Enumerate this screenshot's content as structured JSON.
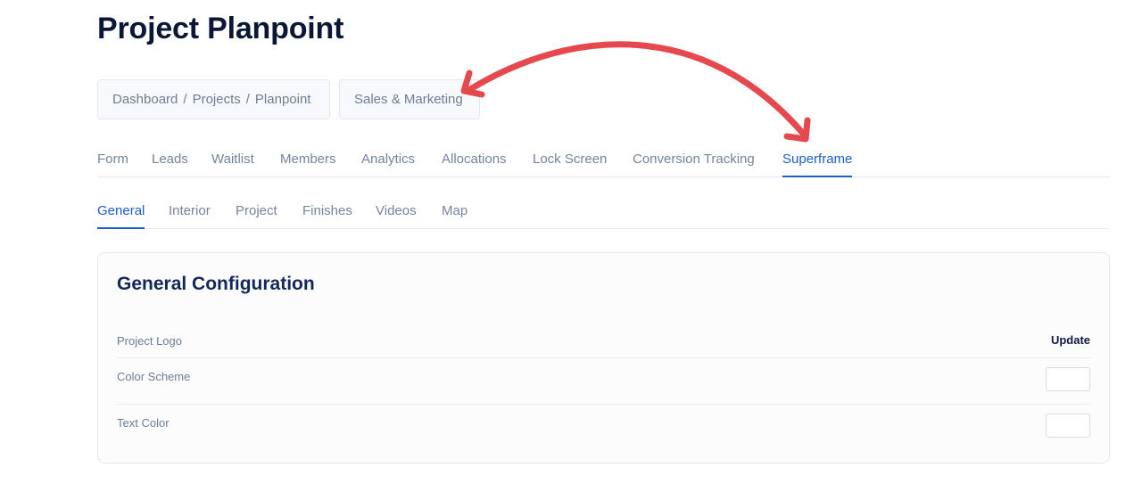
{
  "header": {
    "title_prefix": "Project",
    "title_name": "Planpoint"
  },
  "breadcrumb": {
    "items": [
      "Dashboard",
      "Projects",
      "Planpoint"
    ],
    "separator": "/"
  },
  "group_selector": {
    "label": "Sales & Marketing"
  },
  "main_tabs": [
    {
      "label": "Form",
      "active": false
    },
    {
      "label": "Leads",
      "active": false
    },
    {
      "label": "Waitlist",
      "active": false
    },
    {
      "label": "Members",
      "active": false
    },
    {
      "label": "Analytics",
      "active": false
    },
    {
      "label": "Allocations",
      "active": false
    },
    {
      "label": "Lock Screen",
      "active": false
    },
    {
      "label": "Conversion Tracking",
      "active": false
    },
    {
      "label": "Superframe",
      "active": true
    }
  ],
  "sub_tabs": [
    {
      "label": "General",
      "active": true
    },
    {
      "label": "Interior",
      "active": false
    },
    {
      "label": "Project",
      "active": false
    },
    {
      "label": "Finishes",
      "active": false
    },
    {
      "label": "Videos",
      "active": false
    },
    {
      "label": "Map",
      "active": false
    }
  ],
  "config": {
    "title": "General Configuration",
    "rows": [
      {
        "label": "Project Logo",
        "action": "Update"
      },
      {
        "label": "Color Scheme"
      },
      {
        "label": "Text Color"
      }
    ]
  },
  "colors": {
    "accent": "#1d5fc8",
    "annotation_arrow": "#e5484d"
  }
}
